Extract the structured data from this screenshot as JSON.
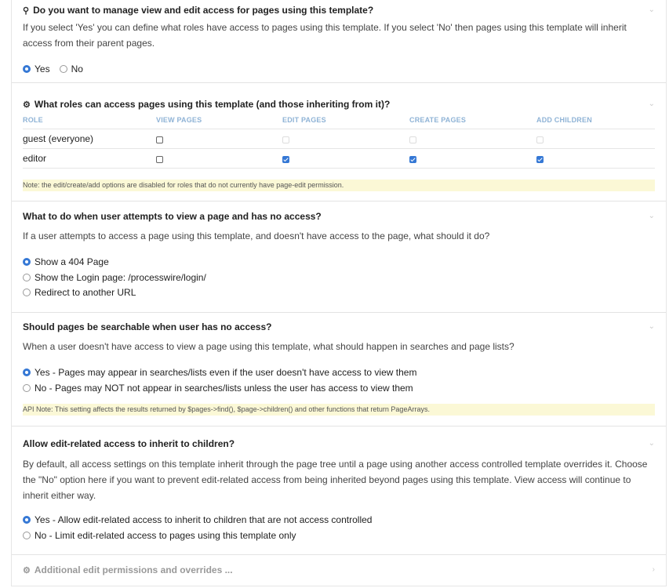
{
  "s1": {
    "title": "Do you want to manage view and edit access for pages using this template?",
    "desc": "If you select 'Yes' you can define what roles have access to pages using this template. If you select 'No' then pages using this template will inherit access from their parent pages.",
    "options": [
      "Yes",
      "No"
    ]
  },
  "s2": {
    "title": "What roles can access pages using this template (and those inheriting from it)?",
    "headers": [
      "ROLE",
      "VIEW PAGES",
      "EDIT PAGES",
      "CREATE PAGES",
      "ADD CHILDREN"
    ],
    "rows": [
      {
        "role": "guest (everyone)"
      },
      {
        "role": "editor"
      }
    ],
    "note": "Note: the edit/create/add options are disabled for roles that do not currently have page-edit permission."
  },
  "s3": {
    "title": "What to do when user attempts to view a page and has no access?",
    "desc": "If a user attempts to access a page using this template, and doesn't have access to the page, what should it do?",
    "options": [
      "Show a 404 Page",
      "Show the Login page: /processwire/login/",
      "Redirect to another URL"
    ]
  },
  "s4": {
    "title": "Should pages be searchable when user has no access?",
    "desc": "When a user doesn't have access to view a page using this template, what should happen in searches and page lists?",
    "options": [
      "Yes - Pages may appear in searches/lists even if the user doesn't have access to view them",
      "No - Pages may NOT not appear in searches/lists unless the user has access to view them"
    ],
    "note": "API Note: This setting affects the results returned by $pages->find(), $page->children() and other functions that return PageArrays."
  },
  "s5": {
    "title": "Allow edit-related access to inherit to children?",
    "desc": "By default, all access settings on this template inherit through the page tree until a page using another access controlled template overrides it. Choose the \"No\" option here if you want to prevent edit-related access from being inherited beyond pages using this template. View access will continue to inherit either way.",
    "options": [
      "Yes - Allow edit-related access to inherit to children that are not access controlled",
      "No - Limit edit-related access to pages using this template only"
    ]
  },
  "s6": {
    "title": "Additional edit permissions and overrides ..."
  },
  "icons": {
    "key": "key-icon",
    "roles": "gears-icon",
    "additional": "gear-icon"
  }
}
